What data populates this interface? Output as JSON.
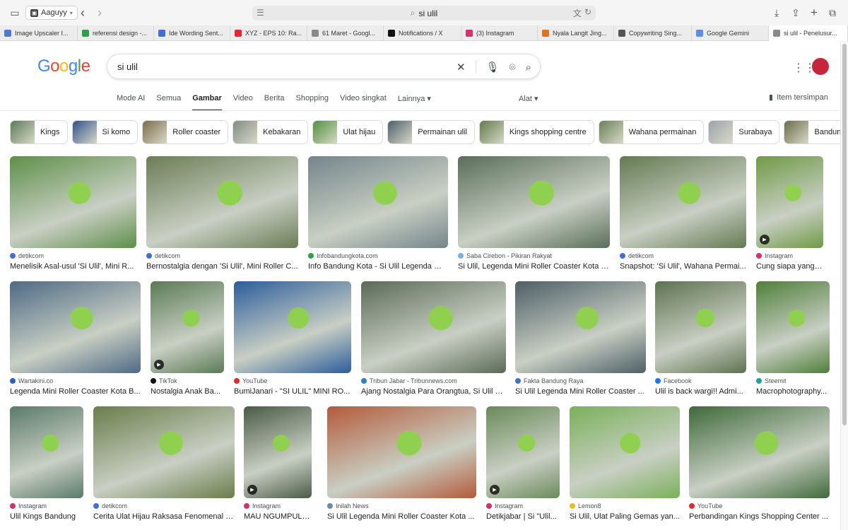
{
  "browser": {
    "profile_name": "Aaguyy",
    "address": "si ulil",
    "tabs": [
      {
        "label": "Image Upscaler I...",
        "color": "#4a7bd0"
      },
      {
        "label": "referensi design -...",
        "color": "#2e9e4f"
      },
      {
        "label": "Ide Wording Sent...",
        "color": "#3f6fd8"
      },
      {
        "label": "XYZ - EPS 10: Ra...",
        "color": "#e8262d"
      },
      {
        "label": "61 Maret - Googl...",
        "color": "#8a8a8a"
      },
      {
        "label": "Notifications / X",
        "color": "#111111"
      },
      {
        "label": "(3) Instagram",
        "color": "#d6306b"
      },
      {
        "label": "Nyala Langit Jing...",
        "color": "#e0731c"
      },
      {
        "label": "Copywriting Sing...",
        "color": "#555555"
      },
      {
        "label": "Google Gemini",
        "color": "#5b8def"
      },
      {
        "label": "si ulil - Penelusur...",
        "color": "#8a8a8a"
      }
    ]
  },
  "google": {
    "logo": "Google",
    "query": "si ulil",
    "nav": [
      "Mode AI",
      "Semua",
      "Gambar",
      "Video",
      "Berita",
      "Shopping",
      "Video singkat",
      "Lainnya ▾"
    ],
    "tools": "Alat ▾",
    "saved": "Item tersimpan"
  },
  "chips": [
    {
      "label": "Kings",
      "color": "#5b7a56"
    },
    {
      "label": "Si komo",
      "color": "#2f4f8a"
    },
    {
      "label": "Roller coaster",
      "color": "#7a6b4a"
    },
    {
      "label": "Kebakaran",
      "color": "#7e8a80"
    },
    {
      "label": "Ulat hijau",
      "color": "#4f8f3b"
    },
    {
      "label": "Permainan ulil",
      "color": "#4a5f6a"
    },
    {
      "label": "Kings shopping centre",
      "color": "#5f7a4a"
    },
    {
      "label": "Wahana permainan",
      "color": "#6a7f5a"
    },
    {
      "label": "Surabaya",
      "color": "#9aa3ab"
    },
    {
      "label": "Bandung",
      "color": "#6a6a4a"
    }
  ],
  "results": [
    {
      "source": "detikcom",
      "title": "Menelisik Asal-usul 'Si Ulil', Mini R...",
      "color": "#5e8f4a",
      "dot": "#3f6fd8",
      "video": false
    },
    {
      "source": "detikcom",
      "title": "Bernostalgia dengan 'Si Ulil', Mini Roller C...",
      "color": "#6b7d55",
      "dot": "#3f6fd8",
      "video": false
    },
    {
      "source": "Infobandungkota.com",
      "title": "Info Bandung Kota - Si Ulil Legenda Mi...",
      "color": "#74858a",
      "dot": "#2e9e4f",
      "video": false
    },
    {
      "source": "Saba Cirebon - Pikiran Rakyat",
      "title": "Si Ulil, Legenda Mini Roller Coaster Kota B...",
      "color": "#5a6e5a",
      "dot": "#7bb0e0",
      "video": false
    },
    {
      "source": "detikcom",
      "title": "Snapshot: 'Si Ulil', Wahana Permai...",
      "color": "#647a52",
      "dot": "#3f6fd8",
      "video": false
    },
    {
      "source": "Instagram",
      "title": "Cung siapa yang p...",
      "color": "#6f9a46",
      "dot": "#d6306b",
      "video": true
    },
    {
      "source": "Wartakini.co",
      "title": "Legenda Mini Roller Coaster Kota B...",
      "color": "#4e6a84",
      "dot": "#2e5fd0",
      "video": false
    },
    {
      "source": "TikTok",
      "title": "Nostalgia Anak Ba...",
      "color": "#5a7a55",
      "dot": "#111111",
      "video": true
    },
    {
      "source": "YouTube",
      "title": "BumiJanari - \"SI ULIL\" MINI RO...",
      "color": "#2c5d9c",
      "dot": "#e8262d",
      "video": false
    },
    {
      "source": "Tribun Jabar - Tribunnews.com",
      "title": "Ajang Nostalgia Para Orangtua, Si Ulil M...",
      "color": "#5b6a58",
      "dot": "#2e7fd0",
      "video": false
    },
    {
      "source": "Fakta Bandung Raya",
      "title": "Si Ulil Legenda Mini Roller Coaster ...",
      "color": "#4e5f66",
      "dot": "#3f6fd8",
      "video": false
    },
    {
      "source": "Facebook",
      "title": "Ulil is back wargi!! Admi...",
      "color": "#5e7250",
      "dot": "#1877f2",
      "video": false
    },
    {
      "source": "Steemit",
      "title": "Macrophotography...",
      "color": "#4f7f3a",
      "dot": "#1fa39a",
      "video": false
    },
    {
      "source": "Instagram",
      "title": "Ulil Kings Bandung",
      "color": "#5a7a6a",
      "dot": "#d6306b",
      "video": false
    },
    {
      "source": "detikcom",
      "title": "Cerita Ulat Hijau Raksasa Fenomenal di...",
      "color": "#6a7d4a",
      "dot": "#3f6fd8",
      "video": false
    },
    {
      "source": "Instagram",
      "title": "MAU NGUMPULIN...",
      "color": "#4a5a46",
      "dot": "#d6306b",
      "video": true
    },
    {
      "source": "Inilah News",
      "title": "Si Ulil Legenda Mini Roller Coaster Kota ...",
      "color": "#b45a3a",
      "dot": "#6a8ab0",
      "video": false
    },
    {
      "source": "Instagram",
      "title": "Detikjabar | Si \"Ulil...",
      "color": "#6a8a5a",
      "dot": "#d6306b",
      "video": true
    },
    {
      "source": "Lemon8",
      "title": "Si Ulil, Ulat Paling Gemas yan...",
      "color": "#7ab05a",
      "dot": "#e0c21c",
      "video": false
    },
    {
      "source": "YouTube",
      "title": "Perbandingan Kings Shopping Center ...",
      "color": "#3f6a3a",
      "dot": "#e8262d",
      "video": false
    }
  ]
}
